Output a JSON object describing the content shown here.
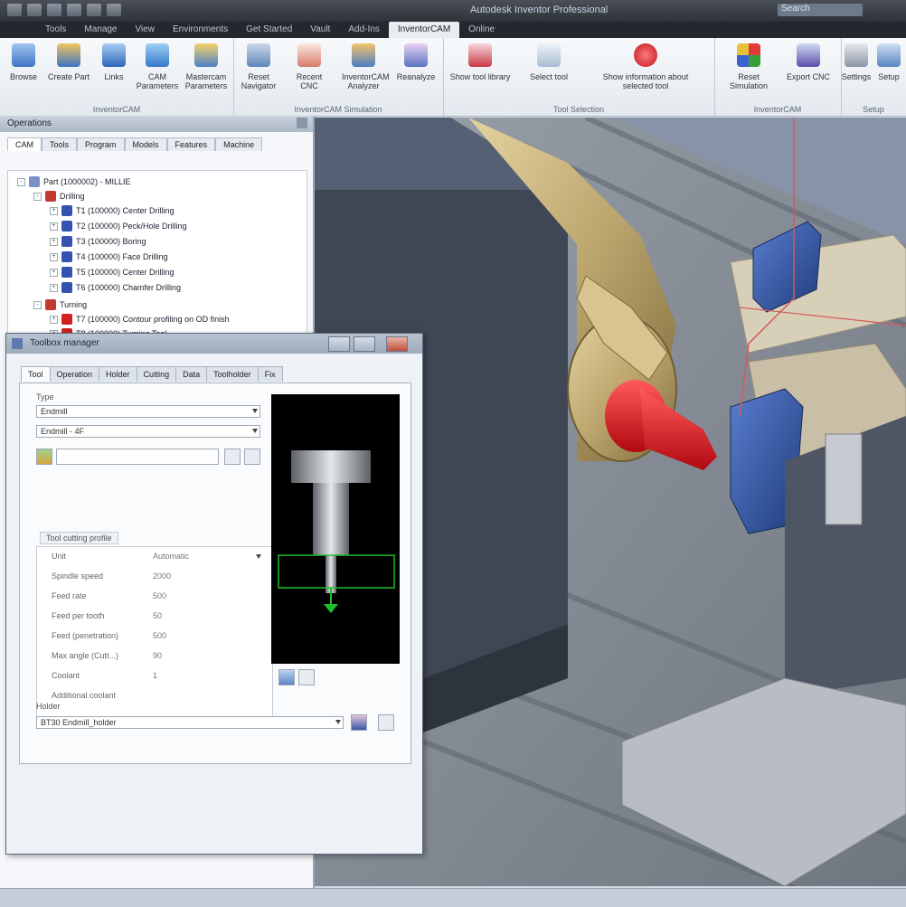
{
  "window": {
    "title": "Autodesk Inventor Professional",
    "search_placeholder": "Search"
  },
  "menu_tabs": [
    "Tools",
    "Manage",
    "View",
    "Environments",
    "Get Started",
    "Vault",
    "Add-Ins",
    "InventorCAM",
    "Online"
  ],
  "ribbon": {
    "groups": [
      {
        "label": "InventorCAM",
        "buttons": [
          "Browse",
          "Create Part",
          "Links",
          "CAM Parameters",
          "Mastercam Parameters"
        ]
      },
      {
        "label": "InventorCAM Simulation",
        "buttons": [
          "Reset Navigator",
          "Recent CNC",
          "InventorCAM Analyzer",
          "Reanalyze"
        ]
      },
      {
        "label": "Tool Selection",
        "buttons": [
          "Show tool library",
          "Select tool",
          "Show information about selected tool"
        ]
      },
      {
        "label": "InventorCAM",
        "buttons": [
          "Reset Simulation",
          "Export CNC"
        ]
      },
      {
        "label": "Setup",
        "buttons": [
          "Settings",
          "Setup"
        ]
      }
    ]
  },
  "browser": {
    "title": "Operations",
    "tabs": [
      "CAM",
      "Tools",
      "Program",
      "Models",
      "Features",
      "Machine"
    ],
    "tree": [
      {
        "label": "Part (1000002) - MILLIE",
        "level": 0
      },
      {
        "label": "Drilling",
        "level": 1
      },
      {
        "label": "T1 (100000) Center Drilling",
        "level": 2
      },
      {
        "label": "T2 (100000) Peck/Hole Drilling",
        "level": 2
      },
      {
        "label": "T3 (100000) Boring",
        "level": 2
      },
      {
        "label": "T4 (100000) Face Drilling",
        "level": 2
      },
      {
        "label": "T5 (100000) Center Drilling",
        "level": 2
      },
      {
        "label": "T6 (100000) Chamfer Drilling",
        "level": 2
      },
      {
        "label": "Turning",
        "level": 1
      },
      {
        "label": "T7 (100000) Contour profiling on OD finish",
        "level": 2
      },
      {
        "label": "T8 (100000) Turning Tool",
        "level": 2
      }
    ]
  },
  "dialog": {
    "title": "Toolbox manager",
    "tabs": [
      "Tool",
      "Operation",
      "Holder",
      "Cutting",
      "Data",
      "Toolholder",
      "Fix"
    ],
    "type_label": "Type",
    "type_value": "Endmill",
    "subtype_value": "Endmill - 4F",
    "section_label": "Tool cutting profile",
    "params": [
      {
        "key": "Unit",
        "value": "Automatic"
      },
      {
        "key": "Spindle speed",
        "value": "2000"
      },
      {
        "key": "Feed rate",
        "value": "500"
      },
      {
        "key": "Feed per tooth",
        "value": "50"
      },
      {
        "key": "Feed (penetration)",
        "value": "500"
      },
      {
        "key": "Max angle (Cutt...)",
        "value": "90"
      },
      {
        "key": "Coolant",
        "value": "1"
      },
      {
        "key": "Additional coolant",
        "value": ""
      }
    ],
    "holder_label": "Holder",
    "holder_value": "BT30 Endmill_holder"
  },
  "colors": {
    "accent": "#2a5fb3",
    "tool_red": "#d4131c",
    "fixture_blue": "#2b4f9a",
    "brass": "#b8a06a"
  }
}
